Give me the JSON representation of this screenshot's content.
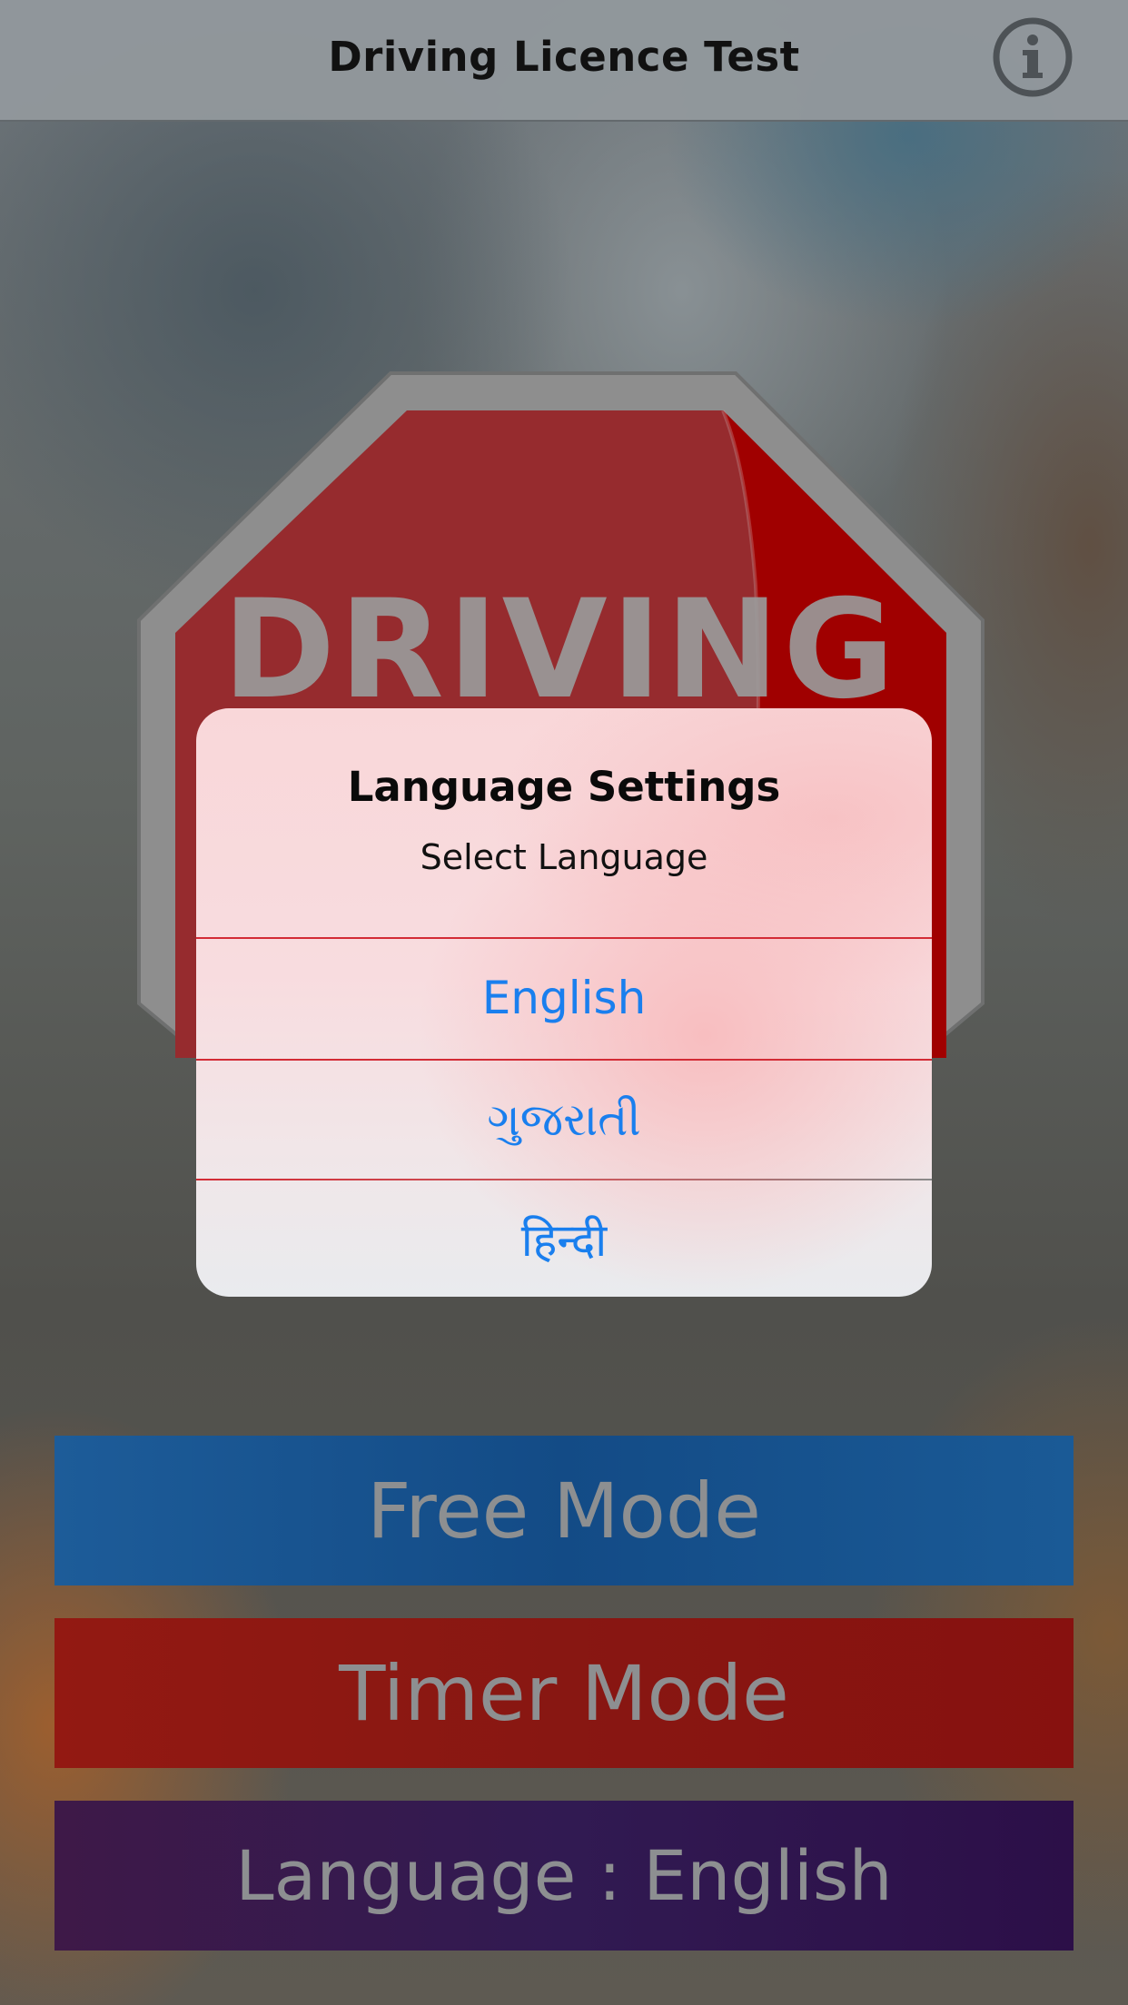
{
  "navbar": {
    "title": "Driving Licence Test",
    "info_icon": "info-circle-icon"
  },
  "background": {
    "sign_text": "DRIVING"
  },
  "dialog": {
    "title": "Language Settings",
    "message": "Select Language",
    "options": [
      {
        "label": "English"
      },
      {
        "label": "ગુજરાતી"
      },
      {
        "label": "हिन्दी"
      }
    ],
    "option_color": "#1a7fee"
  },
  "buttons": {
    "free_mode": "Free Mode",
    "timer_mode": "Timer Mode",
    "language": "Language : English"
  },
  "colors": {
    "free_mode": "#134b86",
    "timer_mode": "#881712",
    "language": "#311a52",
    "dialog_separator": "#d32b35"
  }
}
